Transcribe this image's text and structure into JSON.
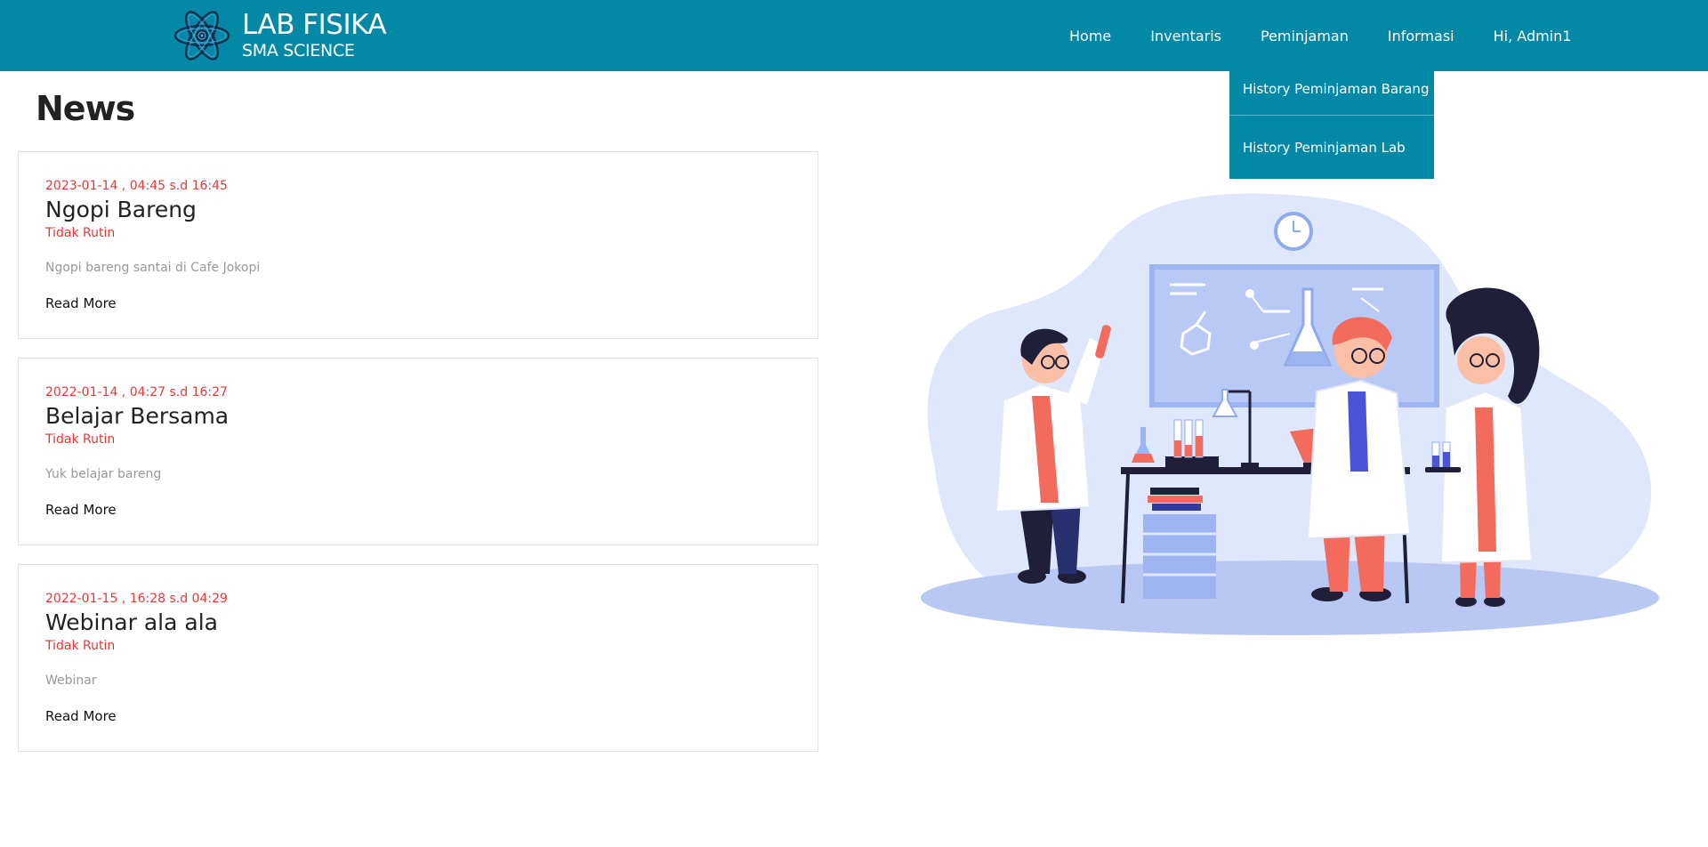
{
  "brand": {
    "title": "LAB FISIKA",
    "subtitle": "SMA SCIENCE",
    "logo_icon": "atom-icon"
  },
  "nav": {
    "items": [
      "Home",
      "Inventaris",
      "Peminjaman",
      "Informasi",
      "Hi, Admin1"
    ]
  },
  "dropdown": {
    "items": [
      "History Peminjaman Barang",
      "History Peminjaman Lab"
    ]
  },
  "news": {
    "heading": "News",
    "items": [
      {
        "date": "2023-01-14 , 04:45 s.d 16:45",
        "title": "Ngopi Bareng",
        "type": "Tidak Rutin",
        "description": "Ngopi bareng santai di Cafe Jokopi",
        "link": "Read More"
      },
      {
        "date": "2022-01-14 , 04:27 s.d 16:27",
        "title": "Belajar Bersama",
        "type": "Tidak Rutin",
        "description": "Yuk belajar bareng",
        "link": "Read More"
      },
      {
        "date": "2022-01-15 , 16:28 s.d 04:29",
        "title": "Webinar ala ala",
        "type": "Tidak Rutin",
        "description": "Webinar",
        "link": "Read More"
      }
    ]
  },
  "colors": {
    "primary": "#0388a6",
    "accent_red": "#e53935"
  }
}
